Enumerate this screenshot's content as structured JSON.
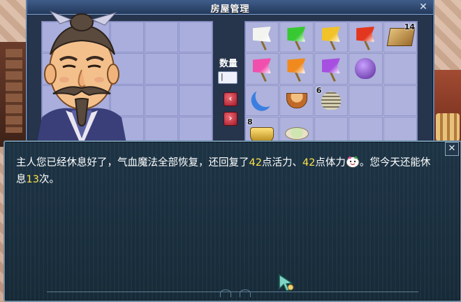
{
  "panel": {
    "title": "房屋管理",
    "close_glyph": "✕",
    "quantity_label": "数量",
    "quantity_value": "|",
    "arrow_left": "‹",
    "arrow_right": "›"
  },
  "inventory": {
    "items": [
      {
        "icon": "flag-white-icon",
        "color": "#f3f3f0",
        "count": ""
      },
      {
        "icon": "flag-green-icon",
        "color": "#38c832",
        "count": ""
      },
      {
        "icon": "flag-yellow-icon",
        "color": "#f1c329",
        "count": ""
      },
      {
        "icon": "flag-red-icon",
        "color": "#e2371e",
        "count": ""
      },
      {
        "icon": "treasure-chest-icon",
        "color": "#d7b066",
        "count": "14"
      },
      {
        "icon": "flag-pink-icon",
        "color": "#f04fae",
        "count": ""
      },
      {
        "icon": "flag-orange-icon",
        "color": "#f08a1f",
        "count": ""
      },
      {
        "icon": "flag-purple-icon",
        "color": "#a64fe0",
        "count": ""
      },
      {
        "icon": "purple-pouch-icon",
        "color": "#8a55d0",
        "count": ""
      },
      {
        "icon": "empty",
        "color": "",
        "count": ""
      },
      {
        "icon": "blue-crescent-icon",
        "color": "#3a7fe0",
        "count": ""
      },
      {
        "icon": "food-bowl-icon",
        "color": "#d58a3a",
        "count": ""
      },
      {
        "icon": "conch-shell-icon",
        "color": "#b0a888",
        "count": "6"
      },
      {
        "icon": "empty",
        "color": "",
        "count": ""
      },
      {
        "icon": "empty",
        "color": "",
        "count": ""
      },
      {
        "icon": "gold-ingot-icon",
        "color": "#e0b638",
        "count": "8"
      },
      {
        "icon": "dish-icon",
        "color": "#cfe6b0",
        "count": ""
      },
      {
        "icon": "empty",
        "color": "",
        "count": ""
      },
      {
        "icon": "empty",
        "color": "",
        "count": ""
      },
      {
        "icon": "empty",
        "color": "",
        "count": ""
      }
    ]
  },
  "dialog": {
    "text_part1": "主人您已经休息好了，气血魔法全部恢复，还回复了",
    "vitality": "42",
    "text_part2": "点活力、",
    "stamina": "42",
    "text_part3": "点体力",
    "text_part4": "。您今天还能休息",
    "rest_times": "13",
    "text_part5": "次。",
    "close_glyph": "✕",
    "emote_icon": "smiling-face-emote-icon"
  },
  "colors": {
    "highlight_number": "#ffe14a",
    "dialog_bg": "#1d3445",
    "panel_title_bg": "#3f5d8a",
    "grid_bg": "#a3a8d8"
  }
}
